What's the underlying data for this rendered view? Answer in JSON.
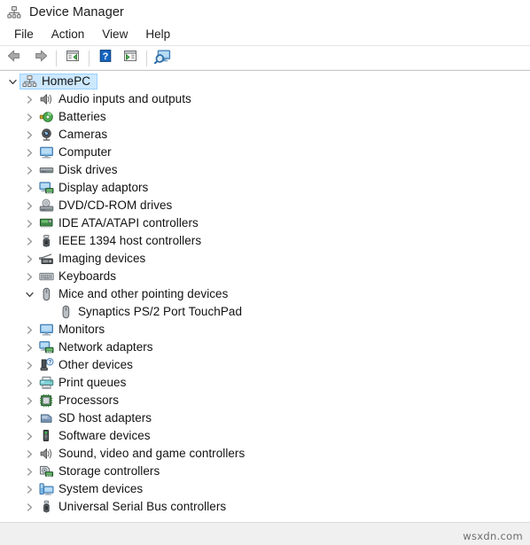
{
  "window": {
    "title": "Device Manager",
    "icon": "device-manager-icon"
  },
  "menubar": {
    "items": [
      {
        "label": "File",
        "name": "menu-file"
      },
      {
        "label": "Action",
        "name": "menu-action"
      },
      {
        "label": "View",
        "name": "menu-view"
      },
      {
        "label": "Help",
        "name": "menu-help"
      }
    ]
  },
  "toolbar": {
    "buttons": [
      {
        "name": "back-button",
        "icon": "back-arrow-icon",
        "tooltip": "Back"
      },
      {
        "name": "forward-button",
        "icon": "forward-arrow-icon",
        "tooltip": "Forward"
      },
      {
        "name": "properties-button",
        "icon": "properties-window-icon",
        "tooltip": "Properties"
      },
      {
        "name": "help-button",
        "icon": "help-question-icon",
        "tooltip": "Help"
      },
      {
        "name": "update-driver-button",
        "icon": "update-driver-window-icon",
        "tooltip": "Update driver"
      },
      {
        "name": "scan-hardware-button",
        "icon": "scan-hardware-monitor-icon",
        "tooltip": "Scan for hardware changes"
      }
    ]
  },
  "tree": {
    "root": {
      "label": "HomePC",
      "icon": "computer-node-icon",
      "expanded": true,
      "selected": true
    },
    "nodes": [
      {
        "label": "Audio inputs and outputs",
        "icon": "speaker-icon",
        "expanded": false,
        "level": 1
      },
      {
        "label": "Batteries",
        "icon": "battery-icon",
        "expanded": false,
        "level": 1
      },
      {
        "label": "Cameras",
        "icon": "camera-icon",
        "expanded": false,
        "level": 1
      },
      {
        "label": "Computer",
        "icon": "monitor-icon",
        "expanded": false,
        "level": 1
      },
      {
        "label": "Disk drives",
        "icon": "disk-drive-icon",
        "expanded": false,
        "level": 1
      },
      {
        "label": "Display adaptors",
        "icon": "display-adapter-icon",
        "expanded": false,
        "level": 1
      },
      {
        "label": "DVD/CD-ROM drives",
        "icon": "dvd-drive-icon",
        "expanded": false,
        "level": 1
      },
      {
        "label": "IDE ATA/ATAPI controllers",
        "icon": "ide-controller-icon",
        "expanded": false,
        "level": 1
      },
      {
        "label": "IEEE 1394 host controllers",
        "icon": "firewire-icon",
        "expanded": false,
        "level": 1
      },
      {
        "label": "Imaging devices",
        "icon": "imaging-device-icon",
        "expanded": false,
        "level": 1
      },
      {
        "label": "Keyboards",
        "icon": "keyboard-icon",
        "expanded": false,
        "level": 1
      },
      {
        "label": "Mice and other pointing devices",
        "icon": "mouse-icon",
        "expanded": true,
        "level": 1
      },
      {
        "label": "Synaptics PS/2 Port TouchPad",
        "icon": "mouse-icon",
        "expanded": null,
        "level": 2
      },
      {
        "label": "Monitors",
        "icon": "monitor-icon",
        "expanded": false,
        "level": 1
      },
      {
        "label": "Network adapters",
        "icon": "network-adapter-icon",
        "expanded": false,
        "level": 1
      },
      {
        "label": "Other devices",
        "icon": "unknown-device-icon",
        "expanded": false,
        "level": 1
      },
      {
        "label": "Print queues",
        "icon": "printer-icon",
        "expanded": false,
        "level": 1
      },
      {
        "label": "Processors",
        "icon": "processor-icon",
        "expanded": false,
        "level": 1
      },
      {
        "label": "SD host adapters",
        "icon": "sd-adapter-icon",
        "expanded": false,
        "level": 1
      },
      {
        "label": "Software devices",
        "icon": "software-device-icon",
        "expanded": false,
        "level": 1
      },
      {
        "label": "Sound, video and game controllers",
        "icon": "speaker-icon",
        "expanded": false,
        "level": 1
      },
      {
        "label": "Storage controllers",
        "icon": "storage-controller-icon",
        "expanded": false,
        "level": 1
      },
      {
        "label": "System devices",
        "icon": "system-device-icon",
        "expanded": false,
        "level": 1
      },
      {
        "label": "Universal Serial Bus controllers",
        "icon": "usb-icon",
        "expanded": false,
        "level": 1
      }
    ]
  },
  "watermark": {
    "text": "wsxdn.com"
  },
  "colors": {
    "selection_bg": "#cce8ff",
    "selection_border": "#99d1ff",
    "chrome_bg": "#ffffff",
    "statusbar_bg": "#f0f0f0",
    "text": "#121212"
  }
}
